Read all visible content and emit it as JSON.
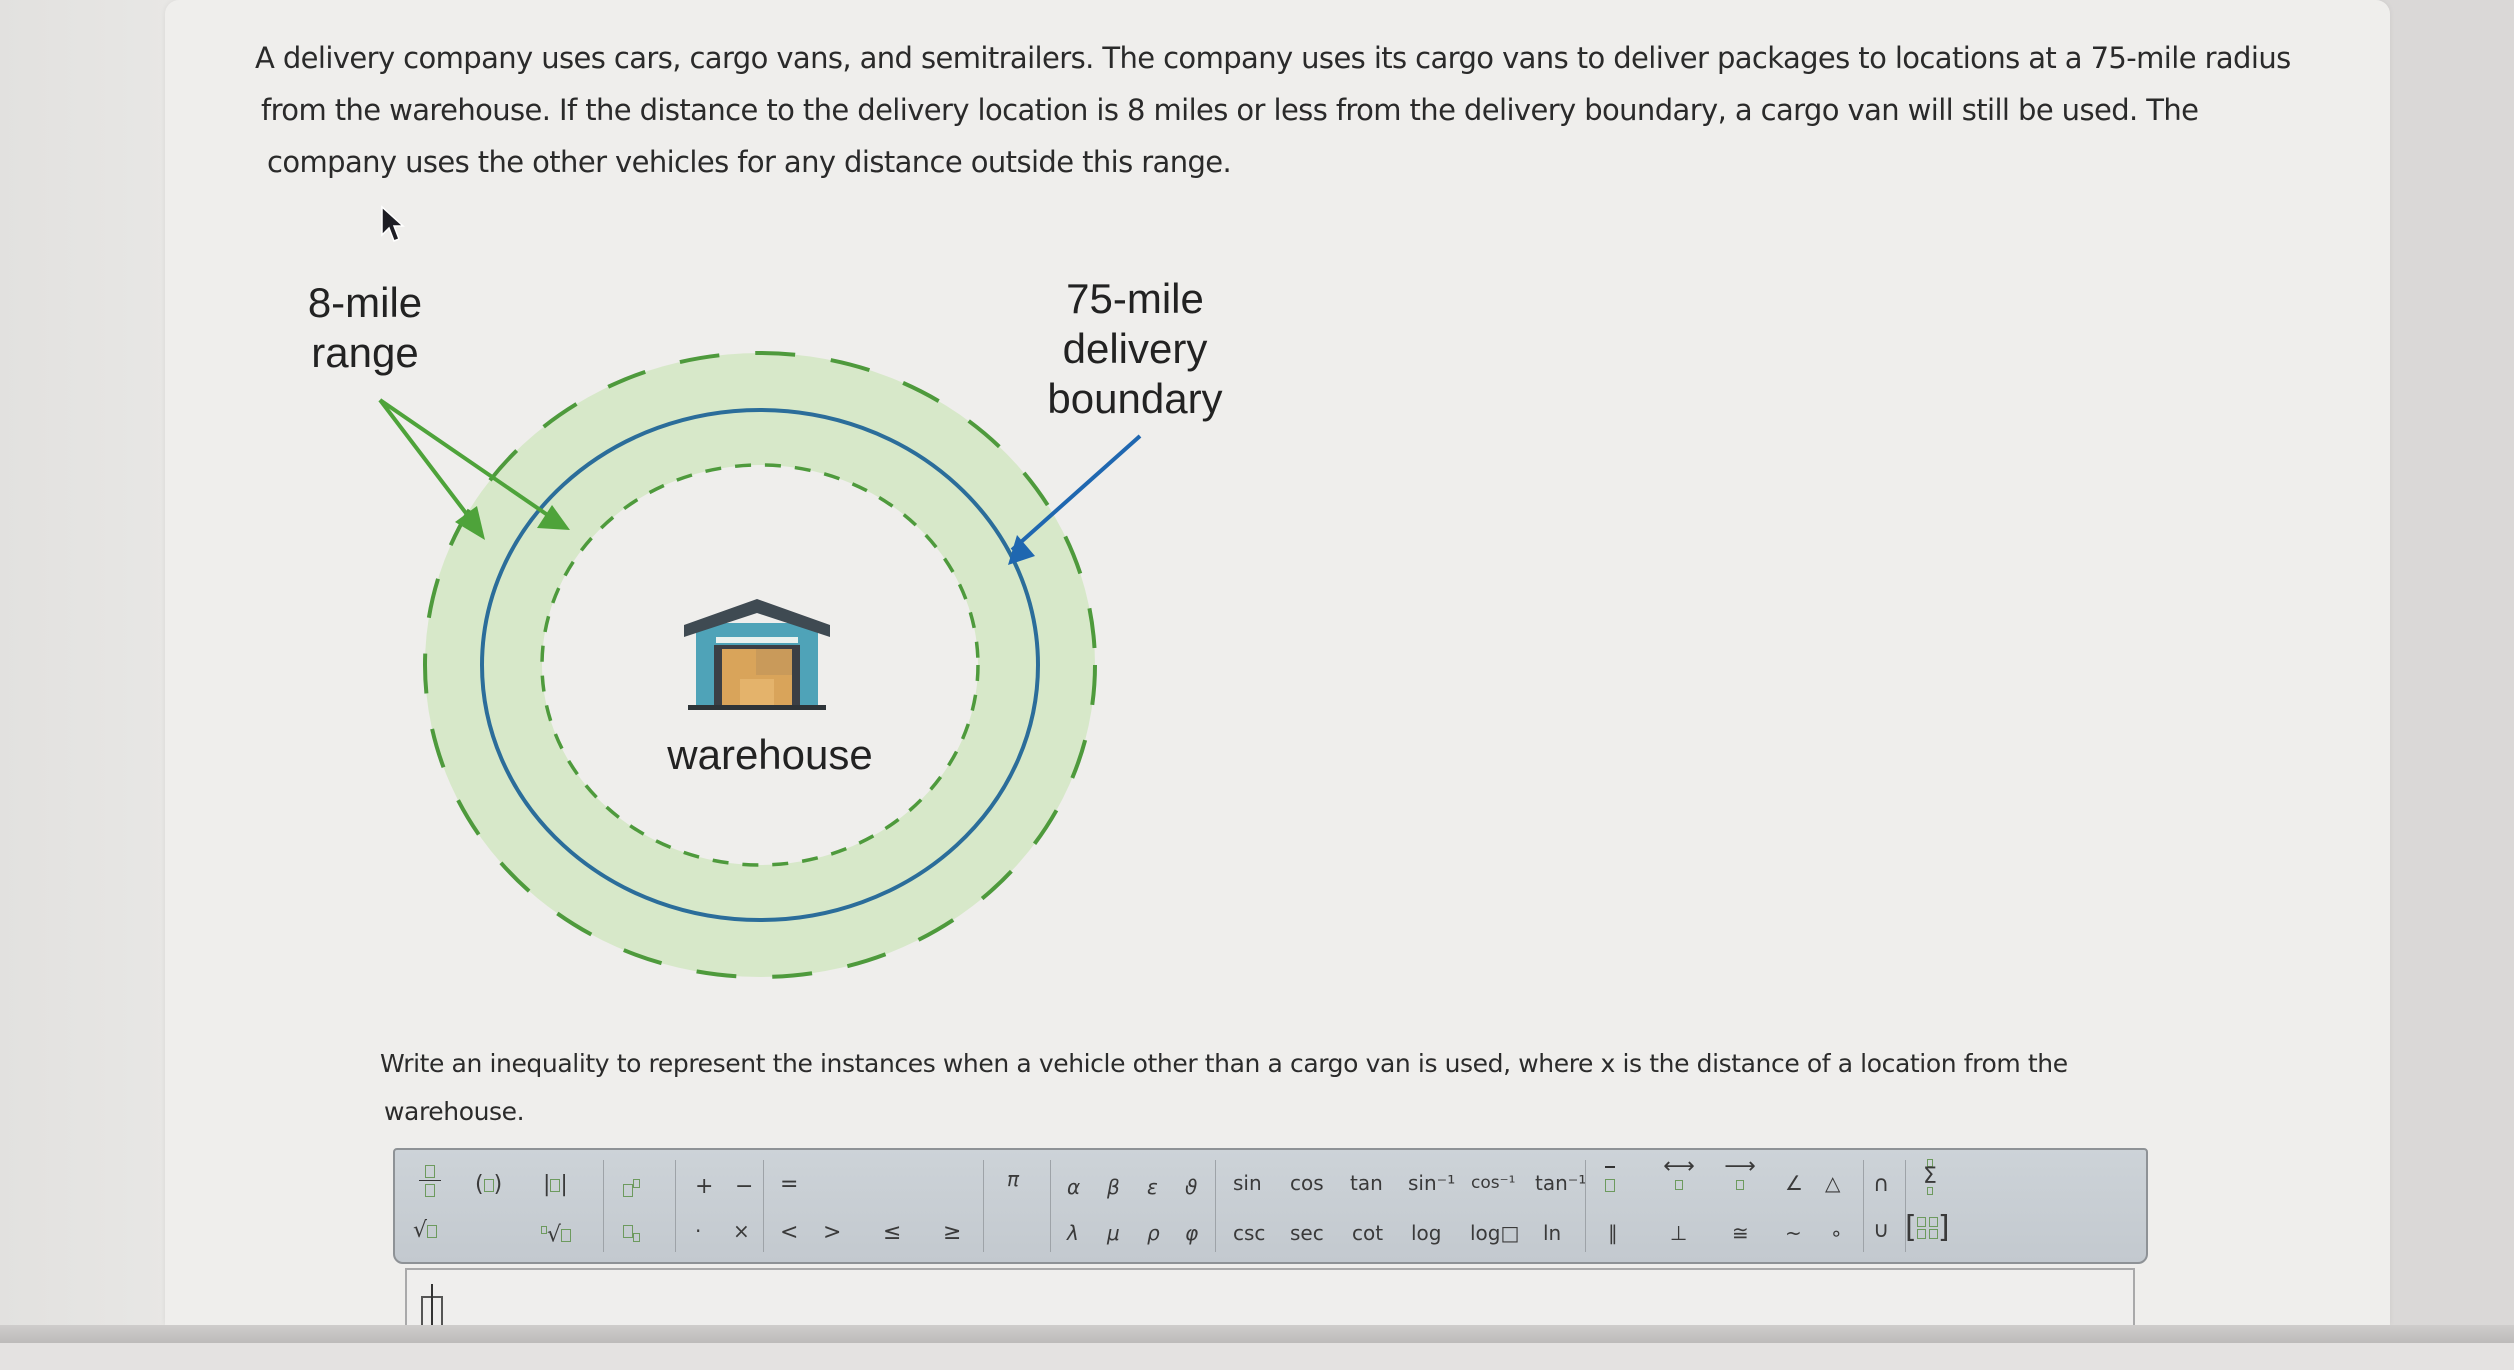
{
  "problem": {
    "lines": [
      "A delivery company uses cars, cargo vans, and semitrailers. The company uses its cargo vans to deliver packages to locations at a 75-mile radius",
      "from the warehouse. If the distance to the delivery location is 8 miles or less from the delivery boundary, a cargo van will still be used. The",
      "company uses the other vehicles for any distance outside this range."
    ]
  },
  "diagram": {
    "range_label_line1": "8-mile",
    "range_label_line2": "range",
    "boundary_label_line1": "75-mile",
    "boundary_label_line2": "delivery",
    "boundary_label_line3": "boundary",
    "center_label": "warehouse",
    "boundary_miles": 75,
    "range_miles": 8,
    "colors": {
      "band_fill": "#d7e8c9",
      "range_arrow": "#4ea33a",
      "dashed_ring": "#4e9a3c",
      "boundary_ring": "#2b6d9a",
      "boundary_arrow": "#1f67b0",
      "warehouse_roof": "#3f4a52",
      "warehouse_wall": "#4fa3b8",
      "warehouse_door": "#d9a45a"
    }
  },
  "question": {
    "line1": "Write an inequality to represent the instances when a vehicle other than a cargo van is used, where x is the distance of a location from the",
    "line2": "warehouse."
  },
  "toolbar": {
    "templates": {
      "fraction": "□/□",
      "parentheses": "(□)",
      "absolute_value": "|□|",
      "square_root": "√□",
      "nth_root": "ⁿ√□",
      "superscript": "□^□",
      "subscript": "□_□"
    },
    "operators": {
      "plus": "+",
      "minus": "−",
      "dot": "·",
      "times": "×"
    },
    "relations": {
      "equals": "=",
      "less": "<",
      "greater": ">",
      "leq": "≤",
      "geq": "≥"
    },
    "pi": "π",
    "greek_row1": [
      "α",
      "β",
      "ε",
      "ϑ"
    ],
    "greek_row2": [
      "λ",
      "μ",
      "ρ",
      "φ"
    ],
    "trig_row1": [
      "sin",
      "cos",
      "tan",
      "sin⁻¹",
      "cos⁻¹",
      "tan⁻¹"
    ],
    "trig_row2": [
      "csc",
      "sec",
      "cot",
      "log",
      "log□",
      "ln"
    ],
    "geometry_row1": [
      "overline",
      "line",
      "ray",
      "∠",
      "△"
    ],
    "geometry_row2": [
      "∥",
      "⊥",
      "≅",
      "~",
      "∘"
    ],
    "set_ops": {
      "intersection": "∩",
      "union": "∪"
    },
    "summation": "Σ",
    "matrix": "matrix"
  },
  "answer": {
    "value": ""
  }
}
